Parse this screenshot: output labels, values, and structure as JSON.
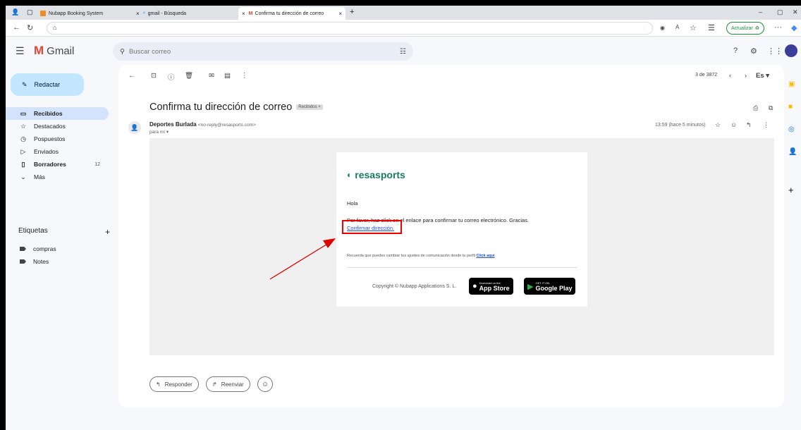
{
  "browser": {
    "tabs": [
      {
        "label": "Nubapp Booking System",
        "favicon_color": "#f28b20"
      },
      {
        "label": "gmail - Búsqueda",
        "favicon_color": "#4285f4"
      },
      {
        "label": "Confirma tu dirección de correo",
        "favicon_color": "#ea4335"
      }
    ],
    "new_tab": "+",
    "close_glyph": "×",
    "update_label": "Actualizar",
    "win_min": "–",
    "win_restore": "▢",
    "win_close": "✕"
  },
  "gmail": {
    "app_name": "Gmail",
    "logo_letter": "M",
    "search_placeholder": "Buscar correo",
    "compose_label": "Redactar",
    "nav": [
      {
        "label": "Recibidos",
        "icon": "inbox-icon",
        "glyph": "▭",
        "count": ""
      },
      {
        "label": "Destacados",
        "icon": "star-icon",
        "glyph": "☆",
        "count": ""
      },
      {
        "label": "Pospuestos",
        "icon": "clock-icon",
        "glyph": "◷",
        "count": ""
      },
      {
        "label": "Enviados",
        "icon": "send-icon",
        "glyph": "▷",
        "count": ""
      },
      {
        "label": "Borradores",
        "icon": "draft-icon",
        "glyph": "▯",
        "count": "12"
      },
      {
        "label": "Más",
        "icon": "chevron-down-icon",
        "glyph": "⌄",
        "count": ""
      }
    ],
    "labels_title": "Etiquetas",
    "labels": [
      "compras",
      "Notes"
    ],
    "pager": "3 de 3872",
    "lang": "Es",
    "email": {
      "subject": "Confirma tu dirección de correo",
      "inbox_badge": "Recibidos ×",
      "sender_name": "Deportes Burlada",
      "sender_addr": "<no-reply@resasports.com>",
      "to": "para mí ▾",
      "timestamp": "13:59 (hace 5 minutos)",
      "brand": "resasports",
      "greeting": "Hola",
      "body": "Por favor, haz click en el enlace para confirmar tu correo electrónico. Gracias.",
      "confirm_link": "Confirmar dirección.",
      "note_prefix": "Recuerda que puedes cambiar tus ajustes de comunicación desde tu perfil ",
      "note_link": "Click aquí",
      "copyright": "Copyright © Nubapp Applications S. L.",
      "appstore_small": "Download on the",
      "appstore_big": "App Store",
      "googleplay_small": "GET IT ON",
      "googleplay_big": "Google Play"
    },
    "reply_label": "Responder",
    "forward_label": "Reenviar"
  },
  "colors": {
    "annotation": "#e00000",
    "compose_bg": "#c2e7ff",
    "active_nav_bg": "#d3e3fd",
    "brand_green": "#1a7d5a"
  }
}
